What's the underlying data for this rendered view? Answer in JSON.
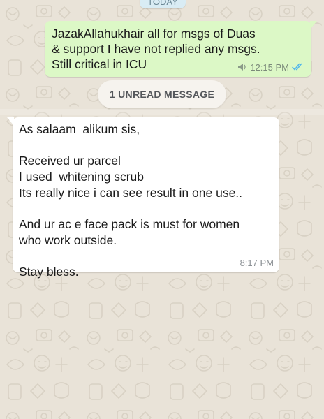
{
  "date_chip": "TODAY",
  "outgoing_message": {
    "text": "JazakAllahukhair all for msgs of Duas\n& support I have not replied any msgs.\nStill critical in ICU",
    "time": "12:15 PM",
    "status_icon": "double-blue-check",
    "bubble_color": "#dcf8c6"
  },
  "unread_banner": {
    "label": "1 UNREAD MESSAGE"
  },
  "incoming_message": {
    "text": "As salaam  alikum sis,\n\nReceived ur parcel\nI used  whitening scrub\nIts really nice i can see result in one use..\n\nAnd ur ac e face pack is must for women\nwho work outside.\n\nStay bless.",
    "time": "8:17 PM",
    "bubble_color": "#ffffff"
  },
  "colors": {
    "wallpaper": "#e9e3d8",
    "read_ticks": "#4fb6ec"
  }
}
